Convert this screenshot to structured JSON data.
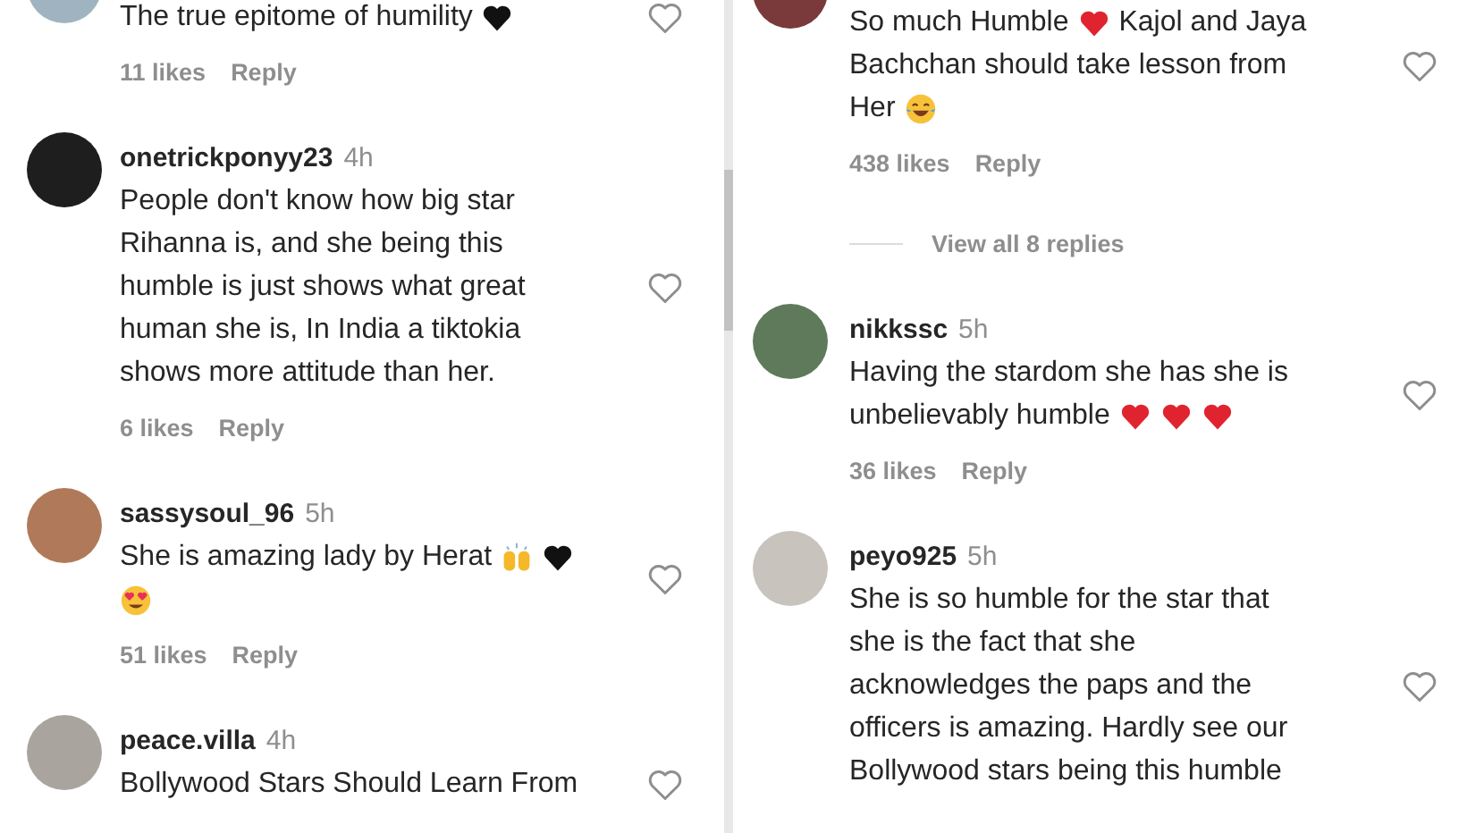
{
  "panels": [
    {
      "comments": [
        {
          "lines": [
            [
              {
                "kind": "text",
                "text": "The true epitome of humility"
              },
              {
                "kind": "black_heart"
              }
            ]
          ],
          "likes": "11 likes",
          "reply": "Reply",
          "liked": false
        },
        {
          "username": "onetrickponyy23",
          "time": "4h",
          "lines": [
            [
              {
                "kind": "text",
                "text": "People don't know how big star"
              }
            ],
            [
              {
                "kind": "text",
                "text": "Rihanna is, and she being this"
              }
            ],
            [
              {
                "kind": "text",
                "text": "humble is just shows what great"
              }
            ],
            [
              {
                "kind": "text",
                "text": "human she is, In India a tiktokia"
              }
            ],
            [
              {
                "kind": "text",
                "text": "shows more attitude than her."
              }
            ]
          ],
          "likes": "6 likes",
          "reply": "Reply",
          "liked": false
        },
        {
          "username": "sassysoul_96",
          "time": "5h",
          "lines": [
            [
              {
                "kind": "text",
                "text": "She is amazing lady by Herat"
              },
              {
                "kind": "raised_hands"
              },
              {
                "kind": "black_heart"
              }
            ],
            [
              {
                "kind": "heart_eyes"
              }
            ]
          ],
          "likes": "51 likes",
          "reply": "Reply",
          "liked": false
        },
        {
          "username": "peace.villa",
          "time": "4h",
          "lines": [
            [
              {
                "kind": "text",
                "text": "Bollywood Stars Should Learn From"
              }
            ]
          ],
          "liked": false
        }
      ]
    },
    {
      "comments": [
        {
          "lines": [
            [
              {
                "kind": "text",
                "text": "So much Humble"
              },
              {
                "kind": "red_heart"
              },
              {
                "kind": "text",
                "text": "Kajol and Jaya"
              }
            ],
            [
              {
                "kind": "text",
                "text": "Bachchan should take lesson from"
              }
            ],
            [
              {
                "kind": "text",
                "text": "Her"
              },
              {
                "kind": "tears_of_joy"
              }
            ]
          ],
          "likes": "438 likes",
          "reply": "Reply",
          "liked": false,
          "view_replies": "View all 8 replies"
        },
        {
          "username": "nikkssc",
          "time": "5h",
          "lines": [
            [
              {
                "kind": "text",
                "text": "Having the stardom she has she is"
              }
            ],
            [
              {
                "kind": "text",
                "text": "unbelievably humble"
              },
              {
                "kind": "red_heart"
              },
              {
                "kind": "red_heart"
              },
              {
                "kind": "red_heart"
              }
            ]
          ],
          "likes": "36 likes",
          "reply": "Reply",
          "liked": false
        },
        {
          "username": "peyo925",
          "time": "5h",
          "lines": [
            [
              {
                "kind": "text",
                "text": "She is so humble for the star that"
              }
            ],
            [
              {
                "kind": "text",
                "text": "she is the fact that she"
              }
            ],
            [
              {
                "kind": "text",
                "text": "acknowledges the paps and the"
              }
            ],
            [
              {
                "kind": "text",
                "text": "officers is amazing. Hardly see our"
              }
            ],
            [
              {
                "kind": "text",
                "text": "Bollywood stars being this humble"
              }
            ]
          ],
          "liked": false
        }
      ]
    }
  ]
}
